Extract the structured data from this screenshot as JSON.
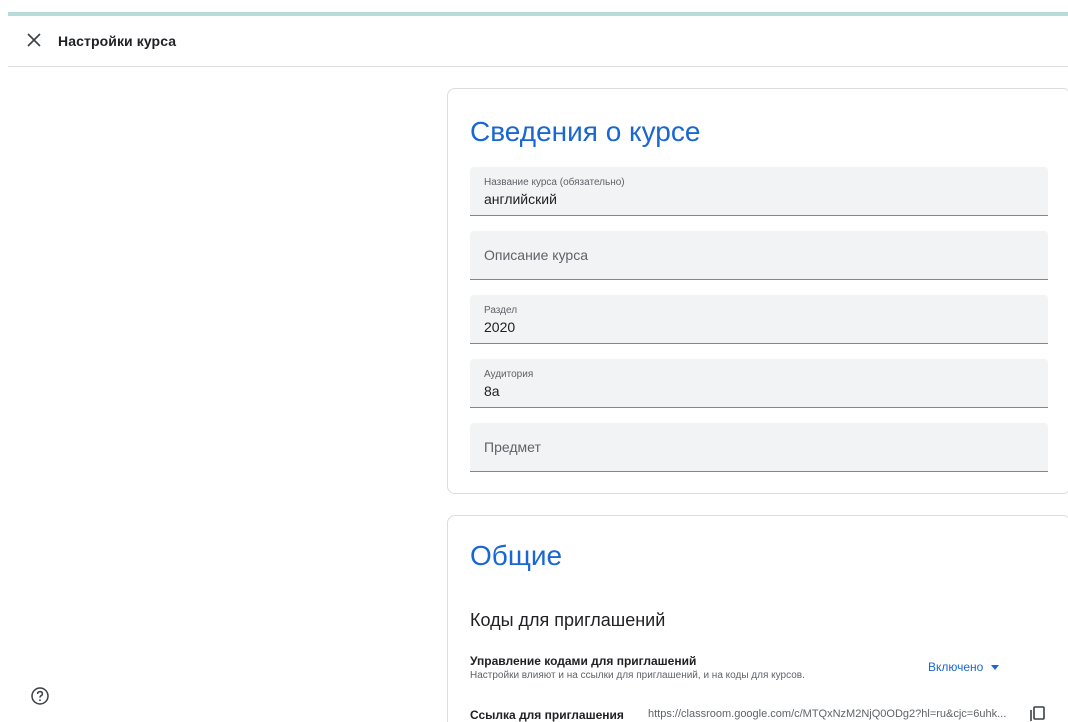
{
  "header": {
    "title": "Настройки курса",
    "close_icon": "close-icon"
  },
  "course_info": {
    "title": "Сведения о курсе",
    "fields": [
      {
        "label": "Название курса (обязательно)",
        "value": "английский"
      },
      {
        "placeholder": "Описание курса"
      },
      {
        "label": "Раздел",
        "value": "2020"
      },
      {
        "label": "Аудитория",
        "value": "8а"
      },
      {
        "placeholder": "Предмет"
      }
    ]
  },
  "general": {
    "title": "Общие",
    "invite_codes_title": "Коды для приглашений",
    "manage_codes": {
      "title": "Управление кодами для приглашений",
      "description": "Настройки влияют и на ссылки для приглашений, и на коды для курсов.",
      "dropdown_value": "Включено"
    },
    "invite_link": {
      "label": "Ссылка для приглашения",
      "url": "https://classroom.google.com/c/MTQxNzM2NjQ0ODg2?hl=ru&cjc=6uhk..."
    }
  },
  "colors": {
    "accent": "#1967d2",
    "top_bar": "#b8dcd9"
  },
  "icons": {
    "close": "close-icon",
    "dropdown": "caret-down-icon",
    "copy": "copy-icon",
    "help": "help-icon"
  }
}
